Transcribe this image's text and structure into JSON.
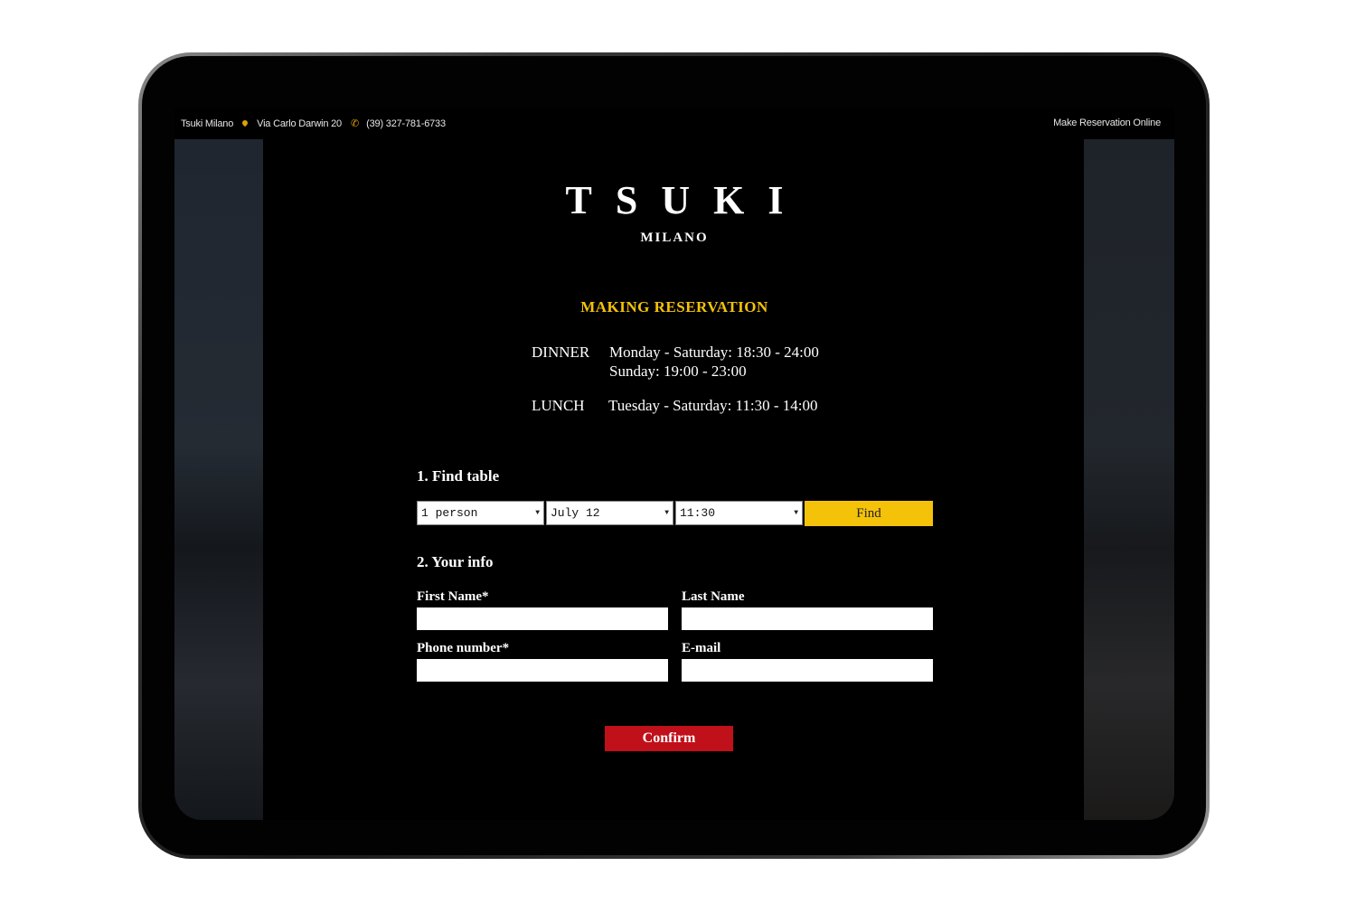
{
  "topbar": {
    "name": "Tsuki Milano",
    "address": "Via Carlo Darwin 20",
    "phone": "(39) 327-781-6733",
    "cta": "Make Reservation Online"
  },
  "brand": {
    "logo": "TSUKI",
    "sub": "MILANO"
  },
  "reservation": {
    "title": "MAKING RESERVATION",
    "dinner_label": "DINNER",
    "dinner_line1": "Monday - Saturday:  18:30 - 24:00",
    "dinner_line2": "Sunday: 19:00 - 23:00",
    "lunch_label": "LUNCH",
    "lunch_line1": "Tuesday - Saturday: 11:30 - 14:00"
  },
  "find": {
    "title": "1. Find table",
    "party": "1 person",
    "date": "July 12",
    "time": "11:30",
    "button": "Find"
  },
  "info": {
    "title": "2. Your info",
    "first_name_label": "First Name*",
    "last_name_label": "Last Name",
    "phone_label": "Phone number*",
    "email_label": "E-mail",
    "confirm": "Confirm"
  },
  "colors": {
    "accent_gold": "#f5c20a",
    "confirm_red": "#c0101a",
    "background": "#000000"
  },
  "icons": {
    "address": "map-pin-icon",
    "phone": "phone-icon",
    "dropdown": "chevron-down-icon"
  }
}
